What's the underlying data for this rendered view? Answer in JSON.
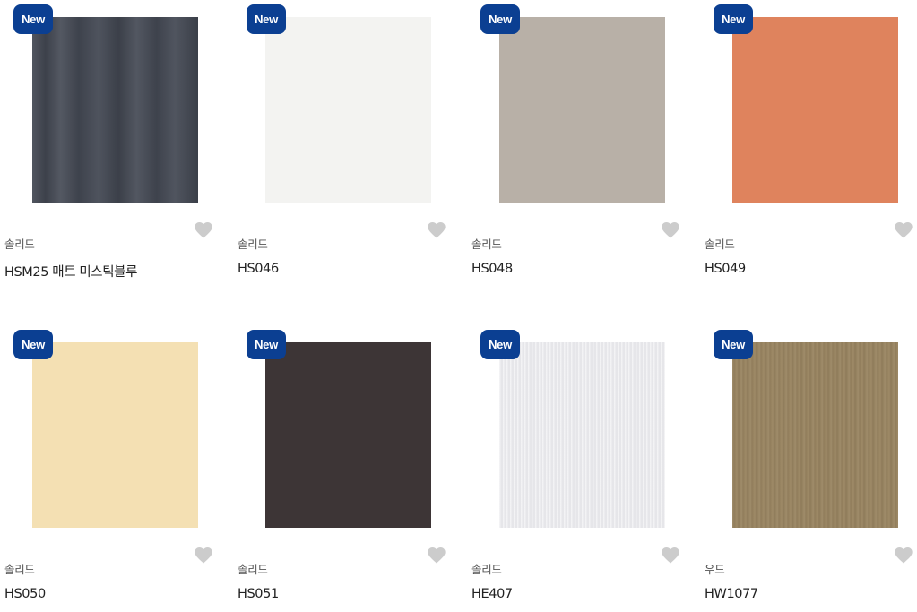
{
  "badge_label": "New",
  "products": [
    {
      "category": "솔리드",
      "name": "HSM25 매트 미스틱블루",
      "color": "#454a55",
      "texture": "mystic"
    },
    {
      "category": "솔리드",
      "name": "HS046",
      "color": "#f3f3f1",
      "texture": "plain"
    },
    {
      "category": "솔리드",
      "name": "HS048",
      "color": "#b8b0a7",
      "texture": "plain"
    },
    {
      "category": "솔리드",
      "name": "HS049",
      "color": "#df835d",
      "texture": "plain"
    },
    {
      "category": "솔리드",
      "name": "HS050",
      "color": "#f4e0b3",
      "texture": "plain"
    },
    {
      "category": "솔리드",
      "name": "HS051",
      "color": "#3d3536",
      "texture": "plain"
    },
    {
      "category": "솔리드",
      "name": "HE407",
      "color": "#ececef",
      "texture": "fine"
    },
    {
      "category": "우드",
      "name": "HW1077",
      "color": "#9a8561",
      "texture": "wood"
    }
  ],
  "colors": {
    "badge": "#0b3f92",
    "heart": "#cccccc"
  }
}
